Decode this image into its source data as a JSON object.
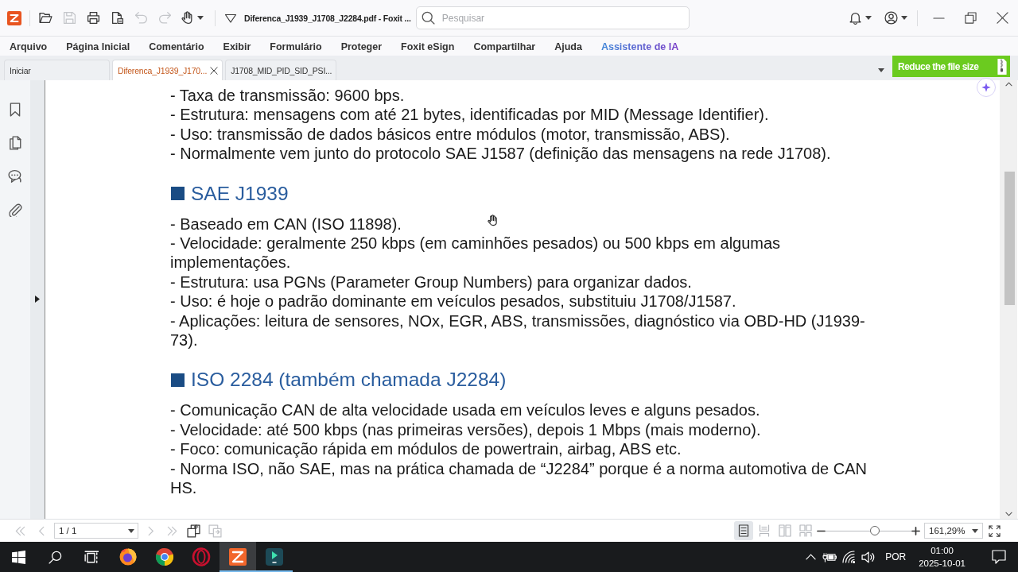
{
  "title_bar": {
    "tools": [
      {
        "disabled": false
      },
      {
        "disabled": true
      },
      {
        "disabled": false
      },
      {
        "disabled": false
      },
      {
        "disabled": true
      },
      {
        "disabled": true
      },
      {
        "disabled": false
      }
    ],
    "title": "Diferenca_J1939_J1708_J2284.pdf - Foxit ...",
    "search": {
      "placeholder": "Pesquisar"
    }
  },
  "menu": [
    {
      "label": "Arquivo",
      "kind": "menu"
    },
    {
      "label": "Página Inicial",
      "kind": "menu"
    },
    {
      "label": "Comentário",
      "kind": "menu"
    },
    {
      "label": "Exibir",
      "kind": "menu"
    },
    {
      "label": "Formulário",
      "kind": "menu"
    },
    {
      "label": "Proteger",
      "kind": "menu"
    },
    {
      "label": "Foxit eSign",
      "kind": "menu"
    },
    {
      "label": "Compartilhar",
      "kind": "menu"
    },
    {
      "label": "Ajuda",
      "kind": "menu"
    },
    {
      "label": "Assistente de IA",
      "kind": "ai"
    }
  ],
  "tabs": [
    {
      "label": "Iniciar",
      "selected": false
    },
    {
      "label": "Diferenca_J1939_J170...",
      "selected": true
    },
    {
      "label": "J1708_MID_PID_SID_PSI...",
      "selected": false
    }
  ],
  "banner": {
    "text": "Reduce the file size"
  },
  "document": {
    "sections": [
      {
        "lines": [
          "- Taxa de transmissão: 9600 bps.",
          "- Estrutura: mensagens com até 21 bytes, identificadas por MID (Message Identifier).",
          "- Uso: transmissão de dados básicos entre módulos (motor, transmissão, ABS).",
          "- Normalmente vem junto do protocolo SAE J1587 (definição das mensagens na rede J1708)."
        ]
      },
      {
        "heading": "SAE J1939",
        "lines": [
          "- Baseado em CAN (ISO 11898).",
          "- Velocidade: geralmente 250 kbps (em caminhões pesados) ou 500 kbps em algumas implementações.",
          "- Estrutura: usa PGNs (Parameter Group Numbers) para organizar dados.",
          "- Uso: é hoje o padrão dominante em veículos pesados, substituiu J1708/J1587.",
          "- Aplicações: leitura de sensores, NOx, EGR, ABS, transmissões, diagnóstico via OBD-HD (J1939-73)."
        ]
      },
      {
        "heading": "ISO 2284 (também chamada J2284)",
        "lines": [
          "- Comunicação CAN de alta velocidade usada em veículos leves e alguns pesados.",
          "- Velocidade: até 500 kbps (nas primeiras versões), depois 1 Mbps (mais moderno).",
          "- Foco: comunicação rápida em módulos de powertrain, airbag, ABS etc.",
          "- Norma ISO, não SAE, mas na prática chamada de “J2284” porque é a norma automotiva de CAN HS."
        ]
      }
    ]
  },
  "nav_bar": {
    "nav_buttons": [
      {
        "disabled": true
      },
      {
        "disabled": true
      },
      {
        "disabled": true
      },
      {
        "disabled": true
      }
    ],
    "page": "1 / 1",
    "page_tools": [
      {
        "disabled": false
      },
      {
        "disabled": true
      }
    ],
    "view_modes": [
      {
        "selected": true
      },
      {
        "selected": false
      },
      {
        "selected": false
      },
      {
        "selected": false
      }
    ],
    "zoom": {
      "level": 0.57,
      "value": "161,29%"
    }
  },
  "taskbar": {
    "apps": [
      {
        "running": false,
        "active": false
      },
      {
        "running": false,
        "active": false
      },
      {
        "running": false,
        "active": false
      },
      {
        "running": true,
        "active": true
      },
      {
        "running": true,
        "active": false
      }
    ],
    "language": "POR",
    "time": "01:00",
    "date": "2025-10-01"
  }
}
